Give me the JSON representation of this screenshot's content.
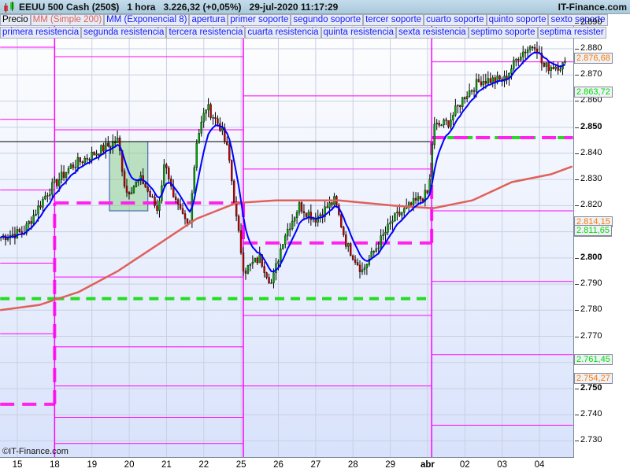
{
  "header": {
    "instrument": "EEUU 500 Cash (250$)",
    "timeframe": "1 hora",
    "price": "3.226,32 (+0,05%)",
    "datetime": "29-jul-2020 11:17:29",
    "site": "IT-Finance.com"
  },
  "legend_row1": [
    "Precio",
    "MM (Simple 200)",
    "MM (Exponencial 8)",
    "apertura",
    "primer soporte",
    "segundo soporte",
    "tercer soporte",
    "cuarto soporte",
    "quinto soporte",
    "sexto soporte"
  ],
  "legend_row2": [
    "primera resistencia",
    "segunda resistencia",
    "tercera resistencia",
    "cuarta resistencia",
    "quinta resistencia",
    "sexta resistencia",
    "septimo soporte",
    "septima resister"
  ],
  "copyright": "©IT-Finance.com",
  "colors": {
    "sma": "#e0605a",
    "ema": "#0000ff",
    "levels": "#ff00ff",
    "pivot": "#00dd00",
    "up": "#00aa00",
    "down": "#cc0000"
  },
  "chart_data": {
    "type": "candlestick",
    "yticks": [
      "2.890",
      "2.880",
      "2.870",
      "2.860",
      "2.850",
      "2.840",
      "2.830",
      "2.820",
      "2.810",
      "2.800",
      "2.790",
      "2.780",
      "2.770",
      "2.760",
      "2.750",
      "2.740",
      "2.730"
    ],
    "ylim": [
      2.7245,
      2.8935
    ],
    "xticks": [
      "15",
      "18",
      "19",
      "20",
      "21",
      "22",
      "25",
      "26",
      "27",
      "28",
      "29",
      "abr",
      "02",
      "03",
      "04"
    ],
    "price_path": [
      [
        -0.46,
        2.808
      ],
      [
        0.17,
        2.81
      ],
      [
        0.8,
        2.825
      ],
      [
        1.44,
        2.835
      ],
      [
        2.07,
        2.84
      ],
      [
        2.7,
        2.845
      ],
      [
        2.91,
        2.825
      ],
      [
        3.34,
        2.83
      ],
      [
        3.76,
        2.818
      ],
      [
        3.97,
        2.838
      ],
      [
        4.18,
        2.822
      ],
      [
        4.6,
        2.812
      ],
      [
        4.81,
        2.845
      ],
      [
        5.07,
        2.858
      ],
      [
        5.45,
        2.85
      ],
      [
        5.66,
        2.84
      ],
      [
        5.87,
        2.815
      ],
      [
        6.08,
        2.795
      ],
      [
        6.5,
        2.8
      ],
      [
        6.82,
        2.79
      ],
      [
        7.14,
        2.808
      ],
      [
        7.56,
        2.82
      ],
      [
        7.98,
        2.815
      ],
      [
        8.51,
        2.822
      ],
      [
        8.83,
        2.805
      ],
      [
        9.25,
        2.795
      ],
      [
        9.67,
        2.805
      ],
      [
        10.09,
        2.815
      ],
      [
        10.73,
        2.822
      ],
      [
        11.04,
        2.825
      ],
      [
        11.15,
        2.85
      ],
      [
        11.57,
        2.852
      ],
      [
        11.99,
        2.862
      ],
      [
        12.42,
        2.868
      ],
      [
        13.05,
        2.868
      ],
      [
        13.47,
        2.878
      ],
      [
        13.89,
        2.882
      ],
      [
        14.1,
        2.873
      ],
      [
        14.74,
        2.874
      ]
    ],
    "sma200": [
      [
        -0.46,
        2.78
      ],
      [
        0.59,
        2.782
      ],
      [
        1.65,
        2.787
      ],
      [
        2.7,
        2.795
      ],
      [
        3.76,
        2.805
      ],
      [
        4.81,
        2.815
      ],
      [
        5.87,
        2.821
      ],
      [
        6.93,
        2.822
      ],
      [
        8.62,
        2.822
      ],
      [
        10.09,
        2.82
      ],
      [
        11.15,
        2.819
      ],
      [
        12.2,
        2.822
      ],
      [
        13.26,
        2.829
      ],
      [
        14.31,
        2.832
      ],
      [
        14.88,
        2.835
      ]
    ],
    "periods": [
      {
        "from": -0.46,
        "to": 1.0,
        "levels": [
          2.8806,
          2.853,
          2.826,
          2.798,
          2.771
        ],
        "pivot_dashed": 2.744,
        "green": 2.7844
      },
      {
        "from": 1.0,
        "to": 6.06,
        "levels": [
          2.877,
          2.849,
          2.7927,
          2.766,
          2.751,
          2.739,
          2.729
        ],
        "pivot_dashed": 2.821,
        "green": 2.7844,
        "black": 2.8445
      },
      {
        "from": 6.06,
        "to": 11.11,
        "levels": [
          2.862,
          2.834,
          2.778,
          2.751
        ],
        "pivot_dashed": 2.8057,
        "green": 2.7844
      },
      {
        "from": 11.11,
        "to": 14.9,
        "levels": [
          2.875,
          2.818,
          2.791,
          2.763,
          2.736
        ],
        "pivot_dashed": 2.846,
        "green": 2.846
      }
    ],
    "price_labels": [
      {
        "text": "2.876,68",
        "value": 2.8767,
        "color": "#ff7700"
      },
      {
        "text": "2.863,72",
        "value": 2.8637,
        "color": "#00dd00"
      },
      {
        "text": "2.814,15",
        "value": 2.8142,
        "color": "#ff7700"
      },
      {
        "text": "2.811,65",
        "value": 2.8106,
        "color": "#0000ff"
      },
      {
        "text": "2.811,65",
        "value": 2.8107,
        "color": "#00dd00"
      },
      {
        "text": "2.761,45",
        "value": 2.7615,
        "color": "#00dd00"
      },
      {
        "text": "2.754,27",
        "value": 2.7543,
        "color": "#ff7700"
      }
    ],
    "highlight_box": {
      "x": [
        2.47,
        3.5
      ],
      "y": [
        2.818,
        2.8445
      ]
    }
  }
}
